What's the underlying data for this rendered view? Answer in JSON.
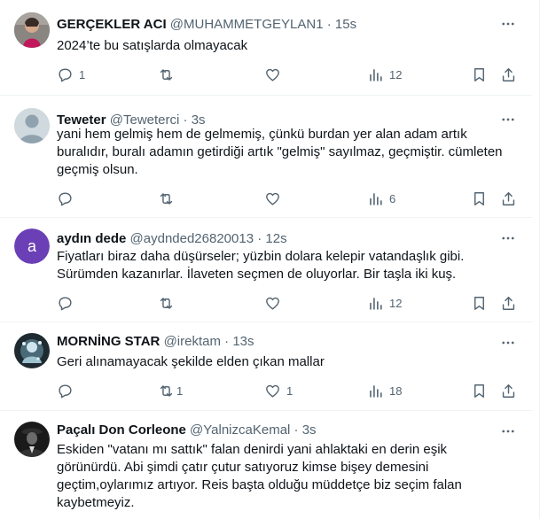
{
  "tweets": [
    {
      "name": "GERÇEKLER ACI",
      "handle": "@MUHAMMETGEYLAN1",
      "sep": "·",
      "time": "15s",
      "text": "2024’te bu satışlarda olmayacak",
      "replies": "1",
      "retweets": "",
      "likes": "",
      "views": "12",
      "avatar": "photo"
    },
    {
      "name": "Teweter",
      "handle": "@Teweterci",
      "sep": "·",
      "time": "3s",
      "text": "yani hem gelmiş hem de gelmemiş, çünkü burdan yer alan adam artık buralıdır, buralı adamın getirdiği artık \"gelmiş\" sayılmaz, geçmiştir. cümleten geçmiş olsun.",
      "replies": "",
      "retweets": "",
      "likes": "",
      "views": "6",
      "avatar": "default"
    },
    {
      "name": "aydın dede",
      "handle": "@aydnded26820013",
      "sep": "·",
      "time": "12s",
      "text": "Fiyatları biraz daha düşürseler; yüzbin dolara kelepir vatandaşlık gibi. Sürümden kazanırlar. İlaveten seçmen de oluyorlar. Bir taşla iki kuş.",
      "replies": "",
      "retweets": "",
      "likes": "",
      "views": "12",
      "avatar": "letter",
      "avatar_letter": "a",
      "avatar_color": "#6b3fb5"
    },
    {
      "name": "MORNİNG STAR",
      "handle": "@irektam",
      "sep": "·",
      "time": "13s",
      "text": "Geri alınamayacak şekilde elden çıkan mallar",
      "replies": "",
      "retweets": "1",
      "likes": "1",
      "views": "18",
      "avatar": "photo"
    },
    {
      "name": "Paçalı Don Corleone",
      "handle": "@YalnizcaKemal",
      "sep": "·",
      "time": "3s",
      "text": "Eskiden \"vatanı mı sattık\" falan denirdi yani ahlaktaki en derin eşik görünürdü. Abi şimdi çatır çutur satıyoruz kimse bişey demesini geçtim,oylarımız artıyor. Reis başta olduğu müddetçe biz seçim falan kaybetmeyiz.",
      "replies": "",
      "retweets": "",
      "likes": "",
      "views": "",
      "avatar": "photo"
    }
  ]
}
